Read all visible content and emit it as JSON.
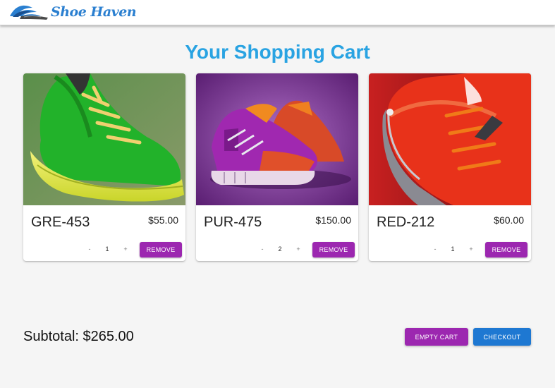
{
  "header": {
    "logo_text": "Shoe Haven",
    "logo_icon": "winged-shoe-icon"
  },
  "page": {
    "title": "Your Shopping Cart"
  },
  "cart": {
    "items": [
      {
        "name": "GRE-453",
        "price": "$55.00",
        "quantity": "1",
        "decrement": "-",
        "increment": "+",
        "remove_label": "REMOVE",
        "image": "green-sneaker-image"
      },
      {
        "name": "PUR-475",
        "price": "$150.00",
        "quantity": "2",
        "decrement": "-",
        "increment": "+",
        "remove_label": "REMOVE",
        "image": "purple-sneaker-image"
      },
      {
        "name": "RED-212",
        "price": "$60.00",
        "quantity": "1",
        "decrement": "-",
        "increment": "+",
        "remove_label": "REMOVE",
        "image": "red-sneaker-image"
      }
    ],
    "subtotal": "Subtotal: $265.00",
    "empty_label": "EMPTY CART",
    "checkout_label": "CHECKOUT"
  },
  "colors": {
    "title": "#29a3e2",
    "remove_button": "#9c27b0",
    "checkout_button": "#1e78d2"
  }
}
